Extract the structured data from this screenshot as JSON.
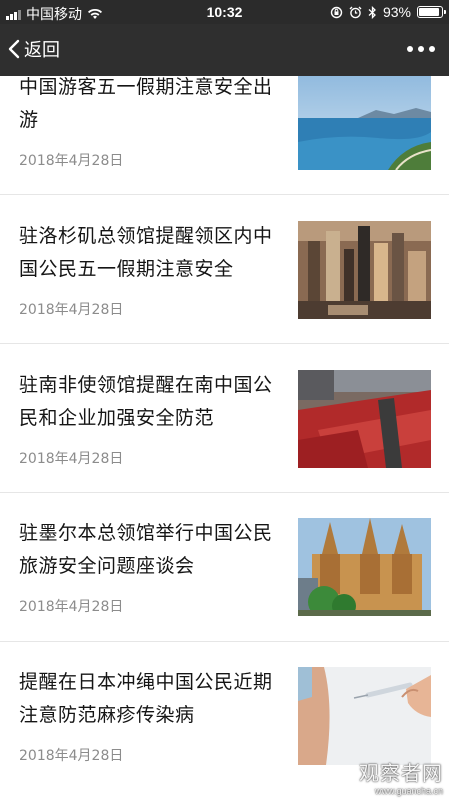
{
  "status_bar": {
    "carrier": "中国移动",
    "time": "10:32",
    "battery": "93%",
    "battery_level": 0.93
  },
  "nav": {
    "back_label": "返回"
  },
  "articles": [
    {
      "title": "中国游客五一假期注意安全出游",
      "date": "2018年4月28日",
      "image": "coastline-photo"
    },
    {
      "title": "驻洛杉矶总领馆提醒领区内中国公民五一假期注意安全",
      "date": "2018年4月28日",
      "image": "city-aerial-photo"
    },
    {
      "title": "驻南非使领馆提醒在南中国公民和企业加强安全防范",
      "date": "2018年4月28日",
      "image": "crowd-photo"
    },
    {
      "title": "驻墨尔本总领馆举行中国公民旅游安全问题座谈会",
      "date": "2018年4月28日",
      "image": "cathedral-photo"
    },
    {
      "title": "提醒在日本冲绳中国公民近期注意防范麻疹传染病",
      "date": "2018年4月28日",
      "image": "vaccination-photo"
    }
  ],
  "watermark": {
    "text": "观察者网",
    "url": "www.guancha.cn"
  }
}
